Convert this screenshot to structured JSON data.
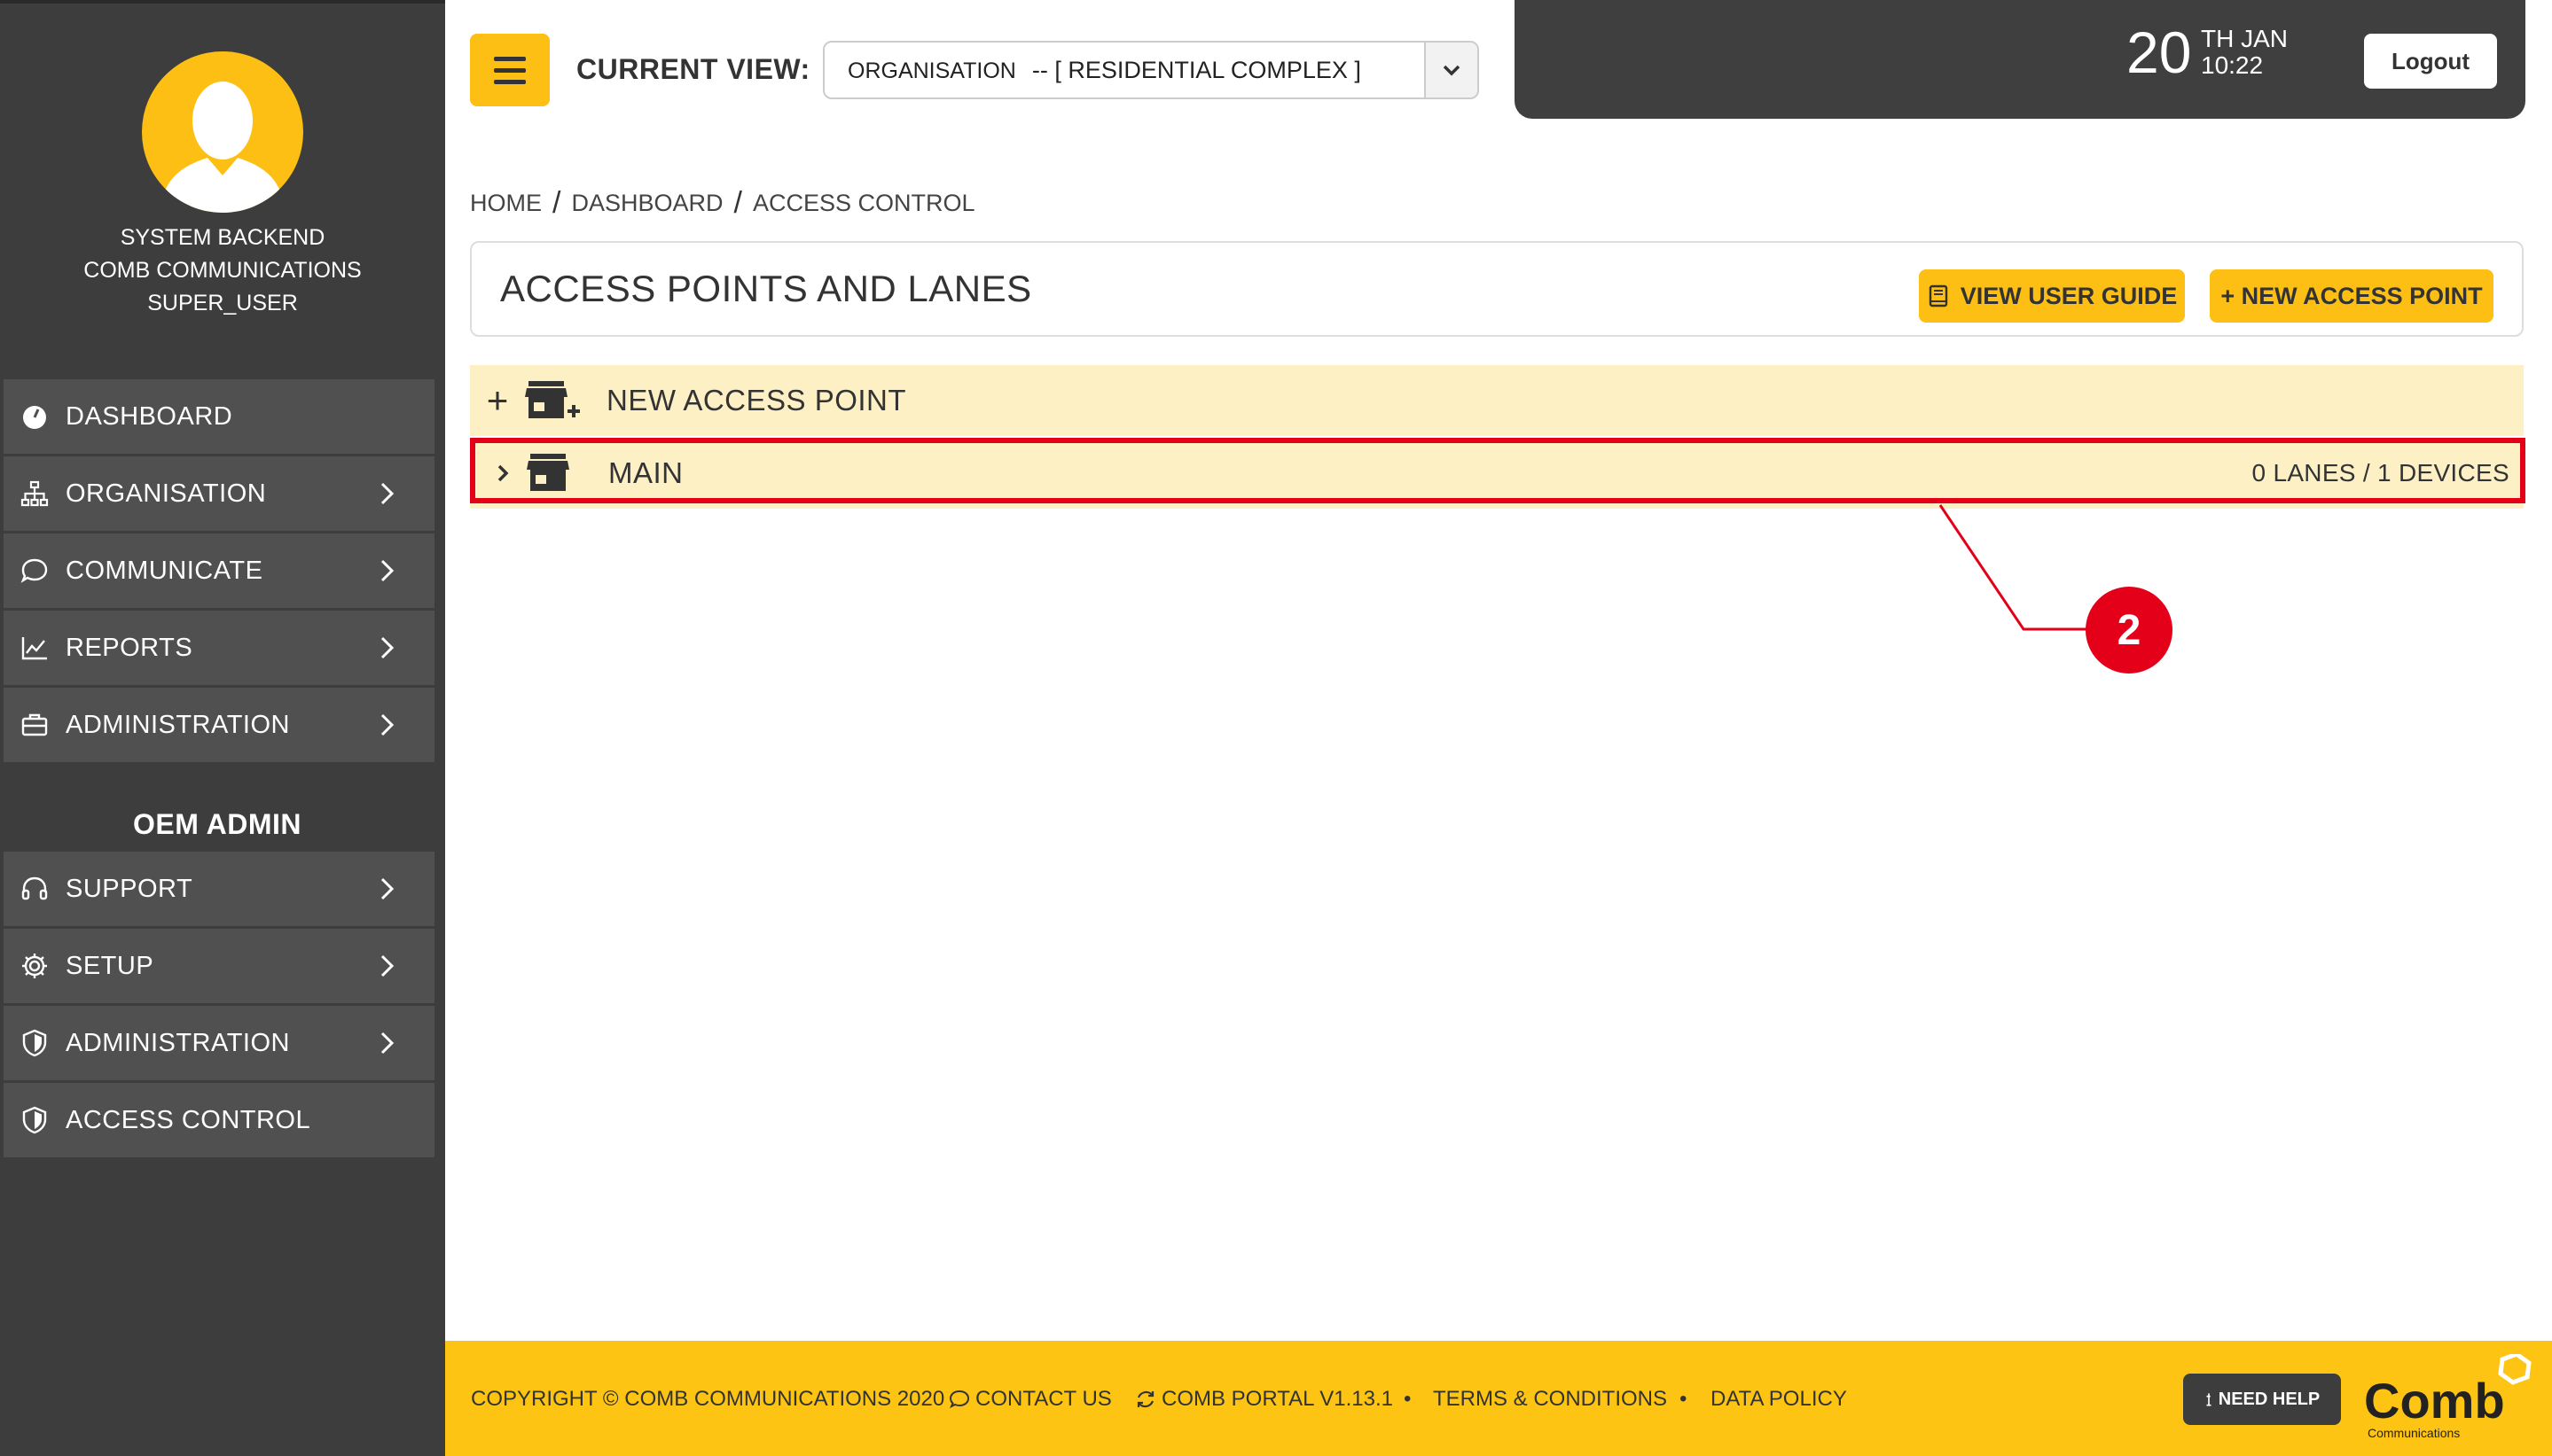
{
  "user": {
    "line1": "SYSTEM BACKEND",
    "line2": "COMB COMMUNICATIONS",
    "line3": "SUPER_USER"
  },
  "sidebar": {
    "main_items": [
      {
        "label": "DASHBOARD",
        "icon": "dashboard-icon"
      },
      {
        "label": "ORGANISATION",
        "icon": "sitemap-icon"
      },
      {
        "label": "COMMUNICATE",
        "icon": "chat-icon"
      },
      {
        "label": "REPORTS",
        "icon": "chart-icon"
      },
      {
        "label": "ADMINISTRATION",
        "icon": "briefcase-icon"
      }
    ],
    "oem_title": "OEM ADMIN",
    "oem_items": [
      {
        "label": "SUPPORT",
        "icon": "headset-icon"
      },
      {
        "label": "SETUP",
        "icon": "gear-icon"
      },
      {
        "label": "ADMINISTRATION",
        "icon": "shield-icon"
      },
      {
        "label": "ACCESS CONTROL",
        "icon": "shield-icon"
      }
    ]
  },
  "header": {
    "current_view_label": "CURRENT VIEW:",
    "view_type": "ORGANISATION",
    "view_value": "-- [ RESIDENTIAL COMPLEX ]",
    "date_day": "20",
    "date_month": "TH JAN",
    "time": "10:22",
    "logout_label": "Logout"
  },
  "breadcrumb": [
    "HOME",
    "DASHBOARD",
    "ACCESS CONTROL"
  ],
  "page": {
    "title": "ACCESS POINTS AND LANES",
    "guide_button": "VIEW USER GUIDE",
    "new_button": "+ NEW ACCESS POINT"
  },
  "list": {
    "new_row_label": "NEW ACCESS POINT",
    "main_row_label": "MAIN",
    "main_row_count": "0 LANES / 1 DEVICES"
  },
  "annotation": {
    "number": "2",
    "color": "#e5001a"
  },
  "footer": {
    "copyright": "COPYRIGHT © COMB COMMUNICATIONS 2020",
    "contact": "CONTACT US",
    "version": "COMB PORTAL V1.13.1",
    "terms": "TERMS & CONDITIONS",
    "policy": "DATA POLICY",
    "need_help": "NEED HELP",
    "logo_text": "Comb",
    "logo_sub": "Communications"
  },
  "colors": {
    "accent": "#fdbf13",
    "sidebar": "#3d3d3d",
    "row": "#fcf0c4",
    "highlight": "#e5001a"
  }
}
